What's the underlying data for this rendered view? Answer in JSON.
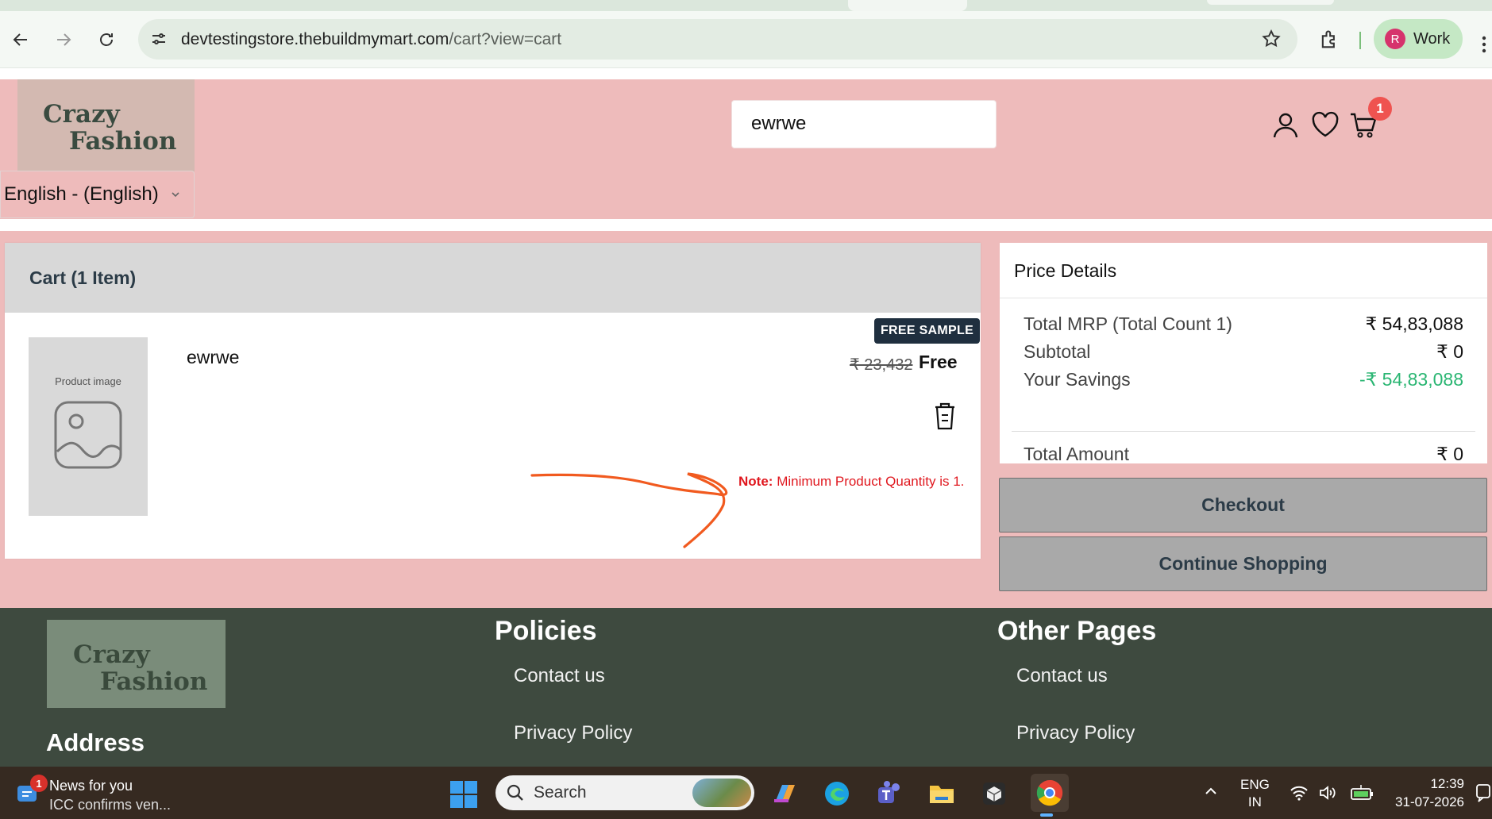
{
  "browser": {
    "url_host": "devtestingstore.thebuildmymart.com",
    "url_path": "/cart?view=cart",
    "profile_initial": "R",
    "profile_label": "Work"
  },
  "header": {
    "logo_line1": "Crazy",
    "logo_line2": "Fashion",
    "language": "English - (English)",
    "search_value": "ewrwe",
    "cart_count": "1"
  },
  "cart": {
    "title": "Cart (1 Item)",
    "item": {
      "image_label": "Product image",
      "name": "ewrwe",
      "badge": "FREE SAMPLE",
      "old_price": "₹ 23,432",
      "price": "Free",
      "note_label": "Note:",
      "note_text": "Minimum Product Quantity is 1."
    }
  },
  "price_details": {
    "title": "Price Details",
    "rows": [
      {
        "label": "Total MRP (Total Count 1)",
        "value": "₹ 54,83,088"
      },
      {
        "label": "Subtotal",
        "value": "₹ 0"
      },
      {
        "label": "Your Savings",
        "value": "-₹ 54,83,088"
      }
    ],
    "total_label": "Total Amount",
    "total_value": "₹ 0",
    "checkout_label": "Checkout",
    "continue_label": "Continue Shopping"
  },
  "footer": {
    "logo_line1": "Crazy",
    "logo_line2": "Fashion",
    "address_title": "Address",
    "policies_title": "Policies",
    "policies_links": [
      "Contact us",
      "Privacy Policy"
    ],
    "other_title": "Other Pages",
    "other_links": [
      "Contact us",
      "Privacy Policy"
    ]
  },
  "taskbar": {
    "news_badge": "1",
    "news_title": "News for you",
    "news_sub": "ICC confirms ven...",
    "search_label": "Search",
    "lang_line1": "ENG",
    "lang_line2": "IN",
    "time": "12:39",
    "date": "31-07-2026"
  },
  "colors": {
    "header_bg": "#eebbbb",
    "footer_bg": "#3e4a3f",
    "savings": "#2bb673",
    "note": "#e0181f",
    "button_bg": "#a9a9a9"
  }
}
